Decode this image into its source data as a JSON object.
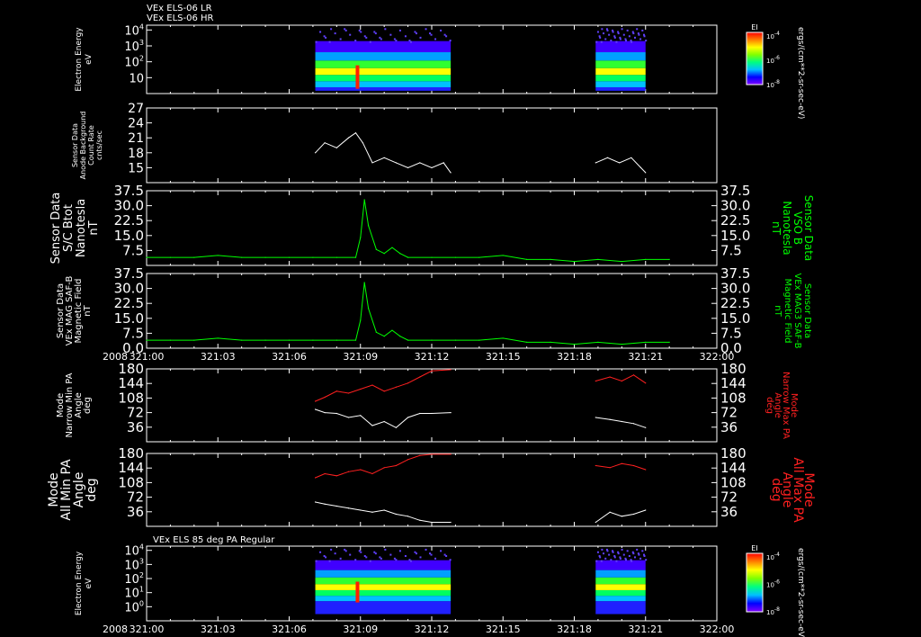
{
  "colors": {
    "white": "#ffffff",
    "green": "#00ff00",
    "red": "#ff2020"
  },
  "chart_data": [
    {
      "type": "heatmap",
      "title": "VEx ELS-06 LR",
      "subtitle": "VEx ELS-06 HR",
      "ylabel": "Electron Energy eV",
      "yscale": "log",
      "ylim": [
        1,
        20000
      ],
      "y_ticks": [
        "10",
        "10^2",
        "10^3",
        "10^4"
      ],
      "colorbar": {
        "label": "EI",
        "units": "ergs/(cm**2-sr-sec-eV)",
        "ticks": [
          "10^-4",
          "10^-6",
          "10^-8"
        ]
      },
      "data_intervals": [
        [
          "321:07:06",
          "321:12:48"
        ],
        [
          "321:18:54",
          "321:21:00"
        ]
      ]
    },
    {
      "type": "line",
      "ylabel": "Sensor Data Anode Background Count Rate cnts/sec",
      "ylim": [
        12,
        27
      ],
      "y_ticks": [
        15,
        18,
        21,
        24,
        27
      ],
      "color": "white",
      "segments": [
        {
          "t": [
            "321:07:06",
            "321:07:30",
            "321:08:00",
            "321:08:30",
            "321:08:48",
            "321:09:06",
            "321:09:30",
            "321:10:00",
            "321:10:30",
            "321:11:00",
            "321:11:30",
            "321:12:00",
            "321:12:30",
            "321:12:48"
          ],
          "y": [
            18,
            20,
            19,
            21,
            22,
            20,
            16,
            17,
            16,
            15,
            16,
            15,
            16,
            14
          ]
        },
        {
          "t": [
            "321:18:54",
            "321:19:24",
            "321:19:54",
            "321:20:24",
            "321:20:48",
            "321:21:00"
          ],
          "y": [
            16,
            17,
            16,
            17,
            15,
            14
          ]
        }
      ]
    },
    {
      "type": "line",
      "ylabel_left": "Sensor Data S/C Btot Nanotesla nT",
      "ylabel_right": "Sensor Data VSO B Nanotesla nT",
      "ylim": [
        0,
        37.5
      ],
      "y_ticks": [
        7.5,
        15.0,
        22.5,
        30.0,
        37.5
      ],
      "color": "green",
      "t": [
        "321:00:00",
        "321:01:00",
        "321:02:00",
        "321:03:00",
        "321:04:00",
        "321:05:00",
        "321:06:00",
        "321:07:00",
        "321:08:00",
        "321:08:48",
        "321:09:00",
        "321:09:10",
        "321:09:20",
        "321:09:40",
        "321:10:00",
        "321:10:20",
        "321:10:40",
        "321:11:00",
        "321:12:00",
        "321:13:00",
        "321:14:00",
        "321:15:00",
        "321:16:00",
        "321:17:00",
        "321:18:00",
        "321:19:00",
        "321:20:00",
        "321:21:00",
        "321:22:00"
      ],
      "y": [
        4,
        4,
        4,
        5,
        4,
        4,
        4,
        4,
        4,
        4,
        14,
        33,
        20,
        8,
        6,
        9,
        6,
        4,
        4,
        4,
        4,
        5,
        3,
        3,
        2,
        3,
        2,
        3,
        3
      ]
    },
    {
      "type": "line",
      "ylabel_left": "Sensor Data VEx MAG SAF-B Magnetic Field nT",
      "ylabel_right": "Sensor Data VEx MAG3 SAF-B Magnetic Field nT",
      "ylim": [
        0,
        37.5
      ],
      "y_ticks": [
        0.0,
        7.5,
        15.0,
        22.5,
        30.0,
        37.5
      ],
      "color": "green",
      "t": [
        "321:00:00",
        "321:01:00",
        "321:02:00",
        "321:03:00",
        "321:04:00",
        "321:05:00",
        "321:06:00",
        "321:07:00",
        "321:08:00",
        "321:08:48",
        "321:09:00",
        "321:09:10",
        "321:09:20",
        "321:09:40",
        "321:10:00",
        "321:10:20",
        "321:10:40",
        "321:11:00",
        "321:12:00",
        "321:13:00",
        "321:14:00",
        "321:15:00",
        "321:16:00",
        "321:17:00",
        "321:18:00",
        "321:19:00",
        "321:20:00",
        "321:21:00",
        "321:22:00"
      ],
      "y": [
        4,
        4,
        4,
        5,
        4,
        4,
        4,
        4,
        4,
        4,
        14,
        33,
        20,
        8,
        6,
        9,
        6,
        4,
        4,
        4,
        4,
        5,
        3,
        3,
        2,
        3,
        2,
        3,
        3
      ],
      "x_axis_year": "2008"
    },
    {
      "type": "line",
      "ylabel_left": "Mode Narrow Min PA Angle deg",
      "ylabel_right": "Mode Narrow Max PA Angle deg",
      "ylim": [
        0,
        180
      ],
      "y_ticks": [
        36,
        72,
        108,
        144,
        180
      ],
      "series": [
        {
          "color": "white",
          "segments": [
            {
              "t": [
                "321:07:06",
                "321:07:30",
                "321:08:00",
                "321:08:30",
                "321:09:00",
                "321:09:30",
                "321:10:00",
                "321:10:30",
                "321:11:00",
                "321:11:30",
                "321:12:00",
                "321:12:48"
              ],
              "y": [
                80,
                72,
                70,
                60,
                65,
                40,
                50,
                35,
                60,
                70,
                70,
                72
              ]
            },
            {
              "t": [
                "321:18:54",
                "321:19:30",
                "321:20:00",
                "321:20:30",
                "321:21:00"
              ],
              "y": [
                60,
                55,
                50,
                45,
                35
              ]
            }
          ]
        },
        {
          "color": "red",
          "segments": [
            {
              "t": [
                "321:07:06",
                "321:07:30",
                "321:08:00",
                "321:08:30",
                "321:09:00",
                "321:09:30",
                "321:10:00",
                "321:10:30",
                "321:11:00",
                "321:11:30",
                "321:12:00",
                "321:12:48"
              ],
              "y": [
                100,
                110,
                125,
                120,
                130,
                140,
                125,
                135,
                145,
                160,
                175,
                178
              ]
            },
            {
              "t": [
                "321:18:54",
                "321:19:30",
                "321:20:00",
                "321:20:30",
                "321:21:00"
              ],
              "y": [
                150,
                160,
                150,
                165,
                145
              ]
            }
          ]
        }
      ]
    },
    {
      "type": "line",
      "ylabel_left": "Mode All Min PA Angle deg",
      "ylabel_right": "Mode All Max PA Angle deg",
      "ylim": [
        0,
        180
      ],
      "y_ticks": [
        36,
        72,
        108,
        144,
        180
      ],
      "series": [
        {
          "color": "white",
          "segments": [
            {
              "t": [
                "321:07:06",
                "321:07:30",
                "321:08:00",
                "321:08:30",
                "321:09:00",
                "321:09:30",
                "321:10:00",
                "321:10:30",
                "321:11:00",
                "321:11:30",
                "321:12:00",
                "321:12:48"
              ],
              "y": [
                60,
                55,
                50,
                45,
                40,
                35,
                40,
                30,
                25,
                15,
                10,
                10
              ]
            },
            {
              "t": [
                "321:18:54",
                "321:19:30",
                "321:20:00",
                "321:20:30",
                "321:21:00"
              ],
              "y": [
                10,
                35,
                25,
                30,
                40
              ]
            }
          ]
        },
        {
          "color": "red",
          "segments": [
            {
              "t": [
                "321:07:06",
                "321:07:30",
                "321:08:00",
                "321:08:30",
                "321:09:00",
                "321:09:30",
                "321:10:00",
                "321:10:30",
                "321:11:00",
                "321:11:30",
                "321:12:00",
                "321:12:48"
              ],
              "y": [
                120,
                130,
                125,
                135,
                140,
                130,
                145,
                150,
                165,
                175,
                178,
                178
              ]
            },
            {
              "t": [
                "321:18:54",
                "321:19:30",
                "321:20:00",
                "321:20:30",
                "321:21:00"
              ],
              "y": [
                150,
                145,
                155,
                150,
                140
              ]
            }
          ]
        }
      ]
    },
    {
      "type": "heatmap",
      "title": "VEx ELS 85 deg PA Regular",
      "ylabel": "Electron Energy eV",
      "yscale": "log",
      "ylim": [
        0.1,
        20000
      ],
      "y_ticks": [
        "10^0",
        "10^1",
        "10^2",
        "10^3",
        "10^4"
      ],
      "colorbar": {
        "label": "EI",
        "units": "ergs/(cm**2-sr-sec-eV)",
        "ticks": [
          "10^-4",
          "10^-6",
          "10^-8"
        ]
      },
      "data_intervals": [
        [
          "321:07:06",
          "321:12:48"
        ],
        [
          "321:18:54",
          "321:21:00"
        ]
      ],
      "x_axis_year": "2008"
    }
  ],
  "x_axis": {
    "range": [
      "321:00:00",
      "322:00:00"
    ],
    "tick_labels": [
      "321:00",
      "321:03",
      "321:06",
      "321:09",
      "321:12",
      "321:15",
      "321:18",
      "321:21",
      "322:00"
    ],
    "year": "2008"
  }
}
